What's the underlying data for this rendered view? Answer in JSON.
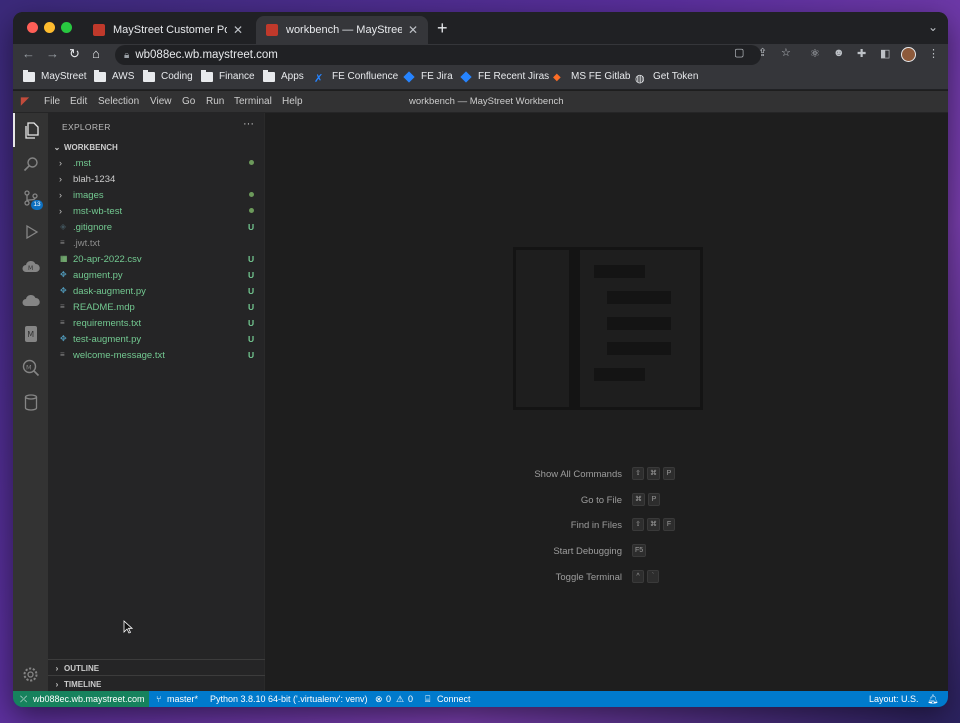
{
  "browser": {
    "tabs": [
      {
        "title": "MayStreet Customer Portal",
        "active": false
      },
      {
        "title": "workbench — MayStreet Workbench",
        "active": true
      }
    ],
    "new_tab": "+",
    "close_glyph": "✕",
    "url": "wb088ec.wb.maystreet.com",
    "bookmarks": [
      {
        "label": "MayStreet",
        "icon": "folder-icon"
      },
      {
        "label": "AWS",
        "icon": "folder-icon"
      },
      {
        "label": "Coding",
        "icon": "folder-icon"
      },
      {
        "label": "Finance",
        "icon": "folder-icon"
      },
      {
        "label": "Apps",
        "icon": "folder-icon"
      },
      {
        "label": "FE Confluence",
        "icon": "confluence-icon"
      },
      {
        "label": "FE Jira",
        "icon": "jira-icon"
      },
      {
        "label": "FE Recent Jiras",
        "icon": "jira-icon"
      },
      {
        "label": "MS FE Gitlab",
        "icon": "gitlab-icon"
      },
      {
        "label": "Get Token",
        "icon": "globe-icon"
      }
    ]
  },
  "vscode": {
    "menu": [
      "File",
      "Edit",
      "Selection",
      "View",
      "Go",
      "Run",
      "Terminal",
      "Help"
    ],
    "window_title": "workbench — MayStreet Workbench",
    "activity": {
      "scm_badge": "13"
    },
    "explorer": {
      "header": "EXPLORER",
      "more": "···",
      "root": "WORKBENCH",
      "items": [
        {
          "name": ".mst",
          "type": "folder",
          "color": "green",
          "decoration": "dot"
        },
        {
          "name": "blah-1234",
          "type": "folder",
          "color": "white",
          "decoration": ""
        },
        {
          "name": "images",
          "type": "folder",
          "color": "green",
          "decoration": "dot"
        },
        {
          "name": "mst-wb-test",
          "type": "folder",
          "color": "green",
          "decoration": "dot"
        },
        {
          "name": ".gitignore",
          "type": "git",
          "color": "green",
          "decoration": "U"
        },
        {
          "name": ".jwt.txt",
          "type": "text",
          "color": "grey",
          "decoration": ""
        },
        {
          "name": "20-apr-2022.csv",
          "type": "csv",
          "color": "green",
          "decoration": "U"
        },
        {
          "name": "augment.py",
          "type": "python",
          "color": "green",
          "decoration": "U"
        },
        {
          "name": "dask-augment.py",
          "type": "python",
          "color": "green",
          "decoration": "U"
        },
        {
          "name": "README.mdp",
          "type": "text",
          "color": "green",
          "decoration": "U"
        },
        {
          "name": "requirements.txt",
          "type": "text",
          "color": "green",
          "decoration": "U"
        },
        {
          "name": "test-augment.py",
          "type": "python",
          "color": "green",
          "decoration": "U"
        },
        {
          "name": "welcome-message.txt",
          "type": "text",
          "color": "green",
          "decoration": "U"
        }
      ],
      "outline": "OUTLINE",
      "timeline": "TIMELINE"
    },
    "commands": [
      {
        "label": "Show All Commands",
        "keys": [
          "⇧",
          "⌘",
          "P"
        ]
      },
      {
        "label": "Go to File",
        "keys": [
          "⌘",
          "P"
        ]
      },
      {
        "label": "Find in Files",
        "keys": [
          "⇧",
          "⌘",
          "F"
        ]
      },
      {
        "label": "Start Debugging",
        "keys": [
          "F5"
        ]
      },
      {
        "label": "Toggle Terminal",
        "keys": [
          "^",
          "`"
        ]
      }
    ],
    "status": {
      "remote": "wb088ec.wb.maystreet.com",
      "branch": "master*",
      "python": "Python 3.8.10 64-bit ('.virtualenv': venv)",
      "errors": "0",
      "warnings": "0",
      "connect": "Connect",
      "layout": "Layout: U.S."
    }
  }
}
